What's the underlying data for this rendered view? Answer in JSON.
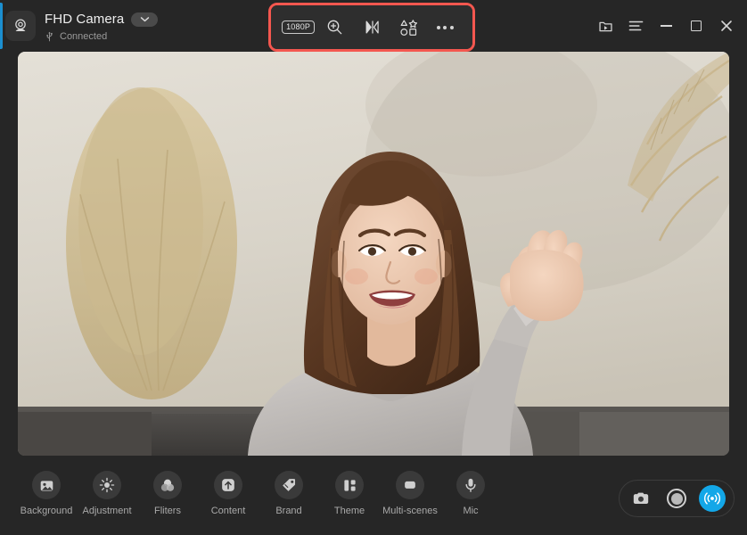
{
  "window": {
    "device_title": "FHD Camera",
    "status": "Connected",
    "device_icon": "webcam-icon",
    "dropdown_icon": "chevron-down-icon",
    "usb_icon": "usb-icon",
    "accent_color": "#1b8fd0",
    "background_color": "#262626"
  },
  "toolbar": {
    "highlight_color": "#f4574f",
    "highlighted": true,
    "items": [
      {
        "name": "resolution-button",
        "label": "1080P",
        "icon": "resolution-badge"
      },
      {
        "name": "zoom-button",
        "label": "",
        "icon": "zoom-in-icon"
      },
      {
        "name": "mirror-button",
        "label": "",
        "icon": "mirror-flip-icon"
      },
      {
        "name": "shapes-button",
        "label": "",
        "icon": "shapes-icon"
      },
      {
        "name": "more-button",
        "label": "",
        "icon": "ellipsis-icon"
      }
    ]
  },
  "window_controls": [
    {
      "name": "media-library-button",
      "icon": "folder-play-icon"
    },
    {
      "name": "menu-button",
      "icon": "hamburger-menu-icon"
    },
    {
      "name": "minimize-button",
      "icon": "minimize-icon"
    },
    {
      "name": "maximize-button",
      "icon": "maximize-icon"
    },
    {
      "name": "close-button",
      "icon": "close-icon"
    }
  ],
  "preview": {
    "name": "camera-preview",
    "description": "Live camera preview of a smiling woman in a grey hoodie waving at the camera, seated on a grey sofa with dried pampas plants and a beige wall behind her."
  },
  "tabs": [
    {
      "label": "Background",
      "icon": "image-icon"
    },
    {
      "label": "Adjustment",
      "icon": "brightness-icon"
    },
    {
      "label": "Fliters",
      "icon": "filters-circles-icon"
    },
    {
      "label": "Content",
      "icon": "upload-arrow-icon"
    },
    {
      "label": "Brand",
      "icon": "tag-icon"
    },
    {
      "label": "Theme",
      "icon": "layout-blocks-icon"
    },
    {
      "label": "Multi-scenes",
      "icon": "scenes-icon"
    },
    {
      "label": "Mic",
      "icon": "microphone-icon"
    }
  ],
  "capture_controls": [
    {
      "name": "snapshot-button",
      "icon": "camera-icon",
      "active": false
    },
    {
      "name": "record-button",
      "icon": "record-circle-icon",
      "active": false
    },
    {
      "name": "live-stream-button",
      "icon": "broadcast-icon",
      "active": true,
      "color": "#13a7e8"
    }
  ]
}
